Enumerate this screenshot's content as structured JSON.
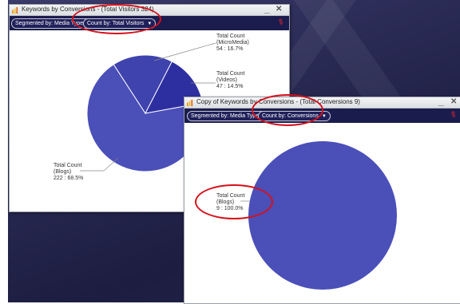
{
  "window1": {
    "title": "Keywords by Conversions - (Total Visitors 324)",
    "segment_label": "Segmented by: Media Type",
    "count_label": "Count by: Total Visitors",
    "minimize": "_",
    "close": "✕",
    "pin_icon": "pin-icon"
  },
  "window2": {
    "title": "Copy of Keywords by Conversions - (Total Conversions 9)",
    "segment_label": "Segmented by: Media Type",
    "count_label": "Count by: Conversions",
    "minimize": "_",
    "close": "✕",
    "pin_icon": "pin-icon"
  },
  "chart_data": [
    {
      "type": "pie",
      "slices": [
        {
          "label": "Total Count (Blogs)",
          "value": 222,
          "percent": 68.5,
          "color": "#4b4fb8"
        },
        {
          "label": "Total Count (MicroMedia)",
          "value": 54,
          "percent": 16.7,
          "color": "#3f43ad"
        },
        {
          "label": "Total Count (Videos)",
          "value": 47,
          "percent": 14.5,
          "color": "#2d2fa0"
        }
      ]
    },
    {
      "type": "pie",
      "slices": [
        {
          "label": "Total Count (Blogs)",
          "value": 9,
          "percent": 100.0,
          "color": "#4b4fb8"
        }
      ]
    }
  ],
  "labels1": {
    "micromedia": {
      "l1": "Total Count",
      "l2": "(MicroMedia)",
      "l3": "54 : 16.7%"
    },
    "videos": {
      "l1": "Total Count",
      "l2": "(Videos)",
      "l3": "47 : 14.5%"
    },
    "blogs": {
      "l1": "Total Count",
      "l2": "(Blogs)",
      "l3": "222 : 68.5%"
    }
  },
  "labels2": {
    "blogs": {
      "l1": "Total Count",
      "l2": "(Blogs)",
      "l3": "9 : 100.0%"
    }
  },
  "colors": {
    "toolbar": "#1b1c4e",
    "slice_main": "#4b4fb8",
    "annotation": "#d4111c"
  }
}
